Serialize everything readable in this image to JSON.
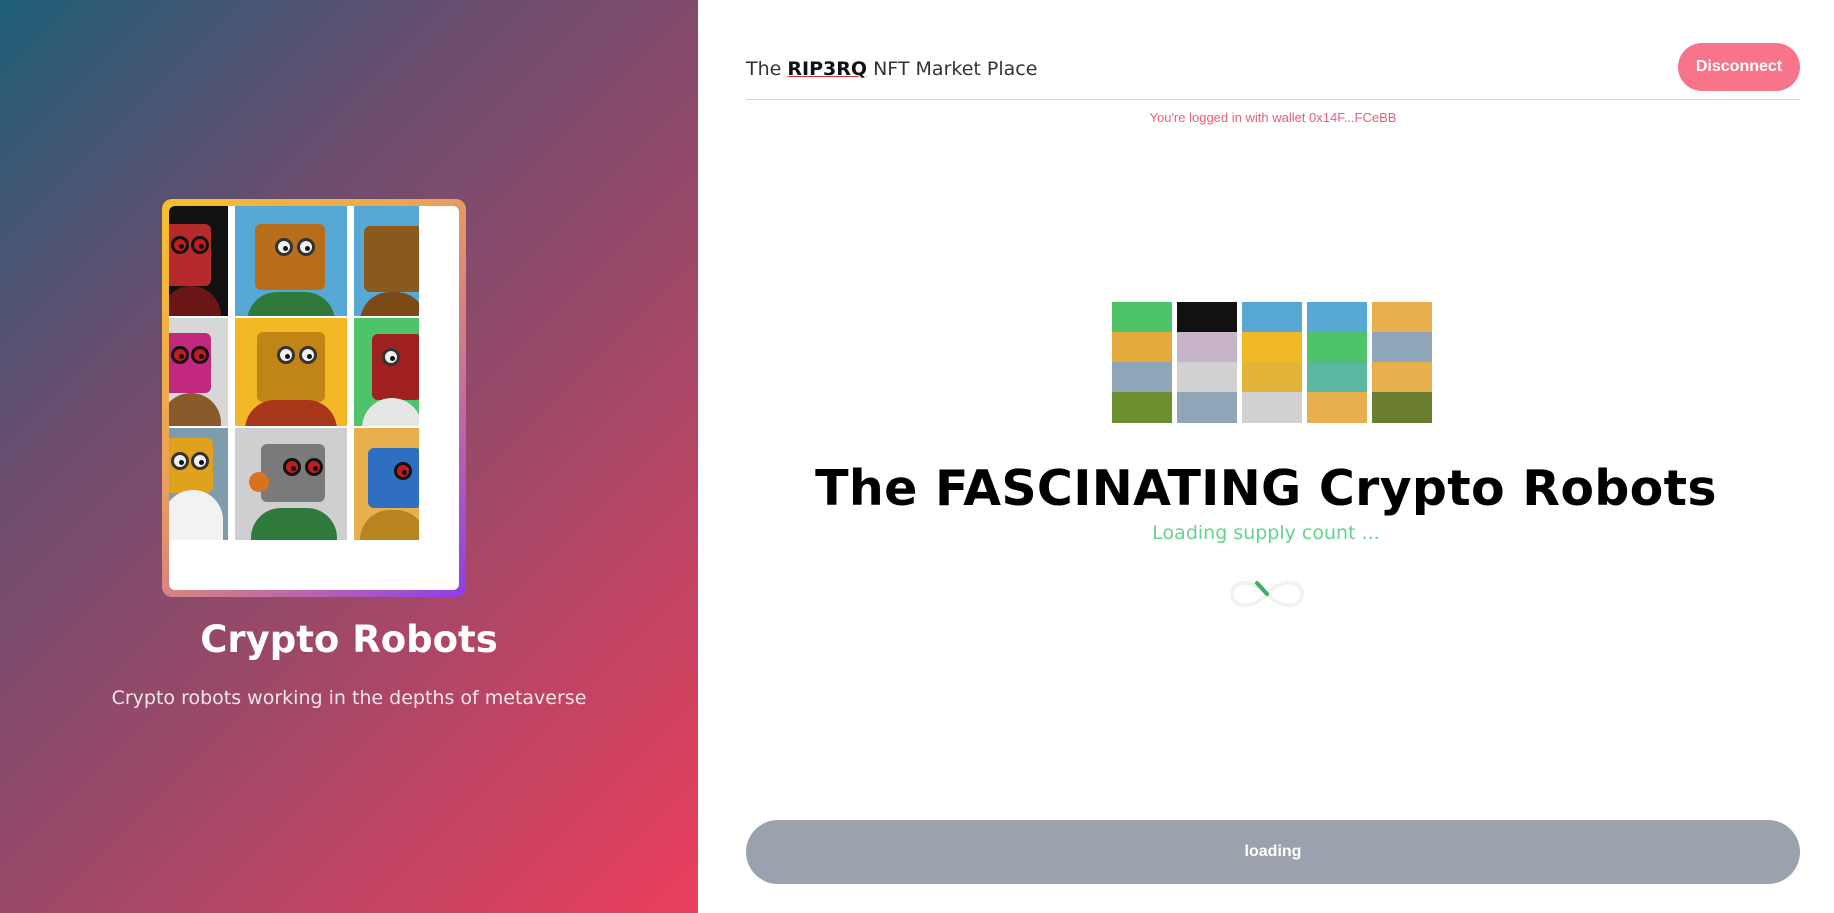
{
  "left_panel": {
    "collection_title": "Crypto Robots",
    "collection_description": "Crypto robots working in the depths of metaverse"
  },
  "header": {
    "brand_prefix": "The",
    "brand_highlight": "RIP3RQ",
    "brand_suffix": "NFT Market Place",
    "disconnect_label": "Disconnect",
    "wallet_notice": "You're logged in with wallet 0x14F...FCeBB"
  },
  "main": {
    "title": "The FASCINATING Crypto Robots",
    "status_text": "Loading supply count ...",
    "action_button_label": "loading"
  },
  "colors": {
    "accent_pink": "#f7748a",
    "loading_green": "#64d38e",
    "button_gray": "#9ca2ad"
  }
}
